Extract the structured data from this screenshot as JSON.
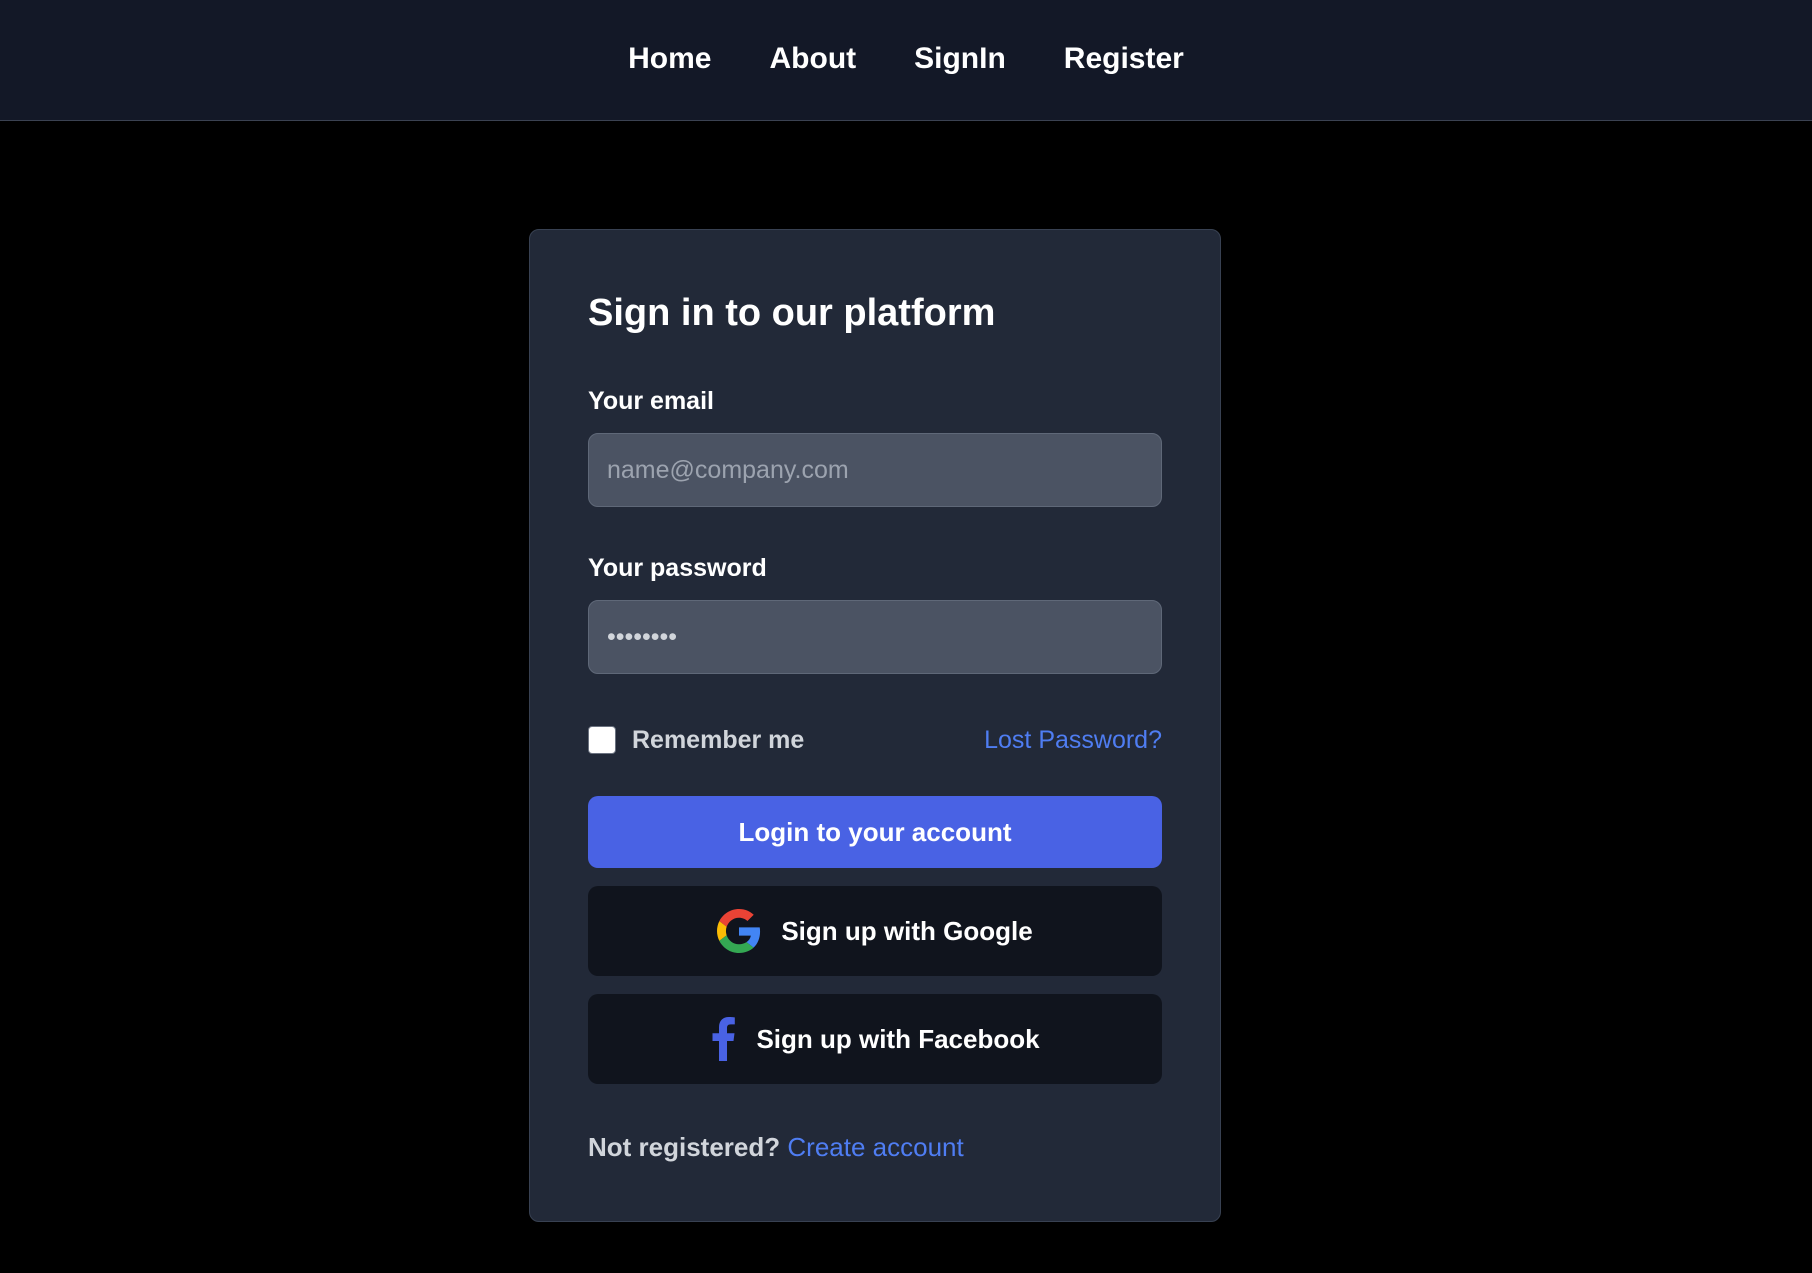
{
  "nav": {
    "items": [
      {
        "label": "Home"
      },
      {
        "label": "About"
      },
      {
        "label": "SignIn"
      },
      {
        "label": "Register"
      }
    ]
  },
  "signin": {
    "title": "Sign in to our platform",
    "email_label": "Your email",
    "email_placeholder": "name@company.com",
    "email_value": "",
    "password_label": "Your password",
    "password_value": "••••••••",
    "remember_label": "Remember me",
    "remember_checked": false,
    "lost_password_label": "Lost Password?",
    "login_button": "Login to your account",
    "google_button": "Sign up with Google",
    "facebook_button": "Sign up with Facebook",
    "not_registered": "Not registered?",
    "create_account": "Create account"
  },
  "icons": {
    "google": "google-g-icon",
    "facebook": "facebook-f-icon"
  },
  "colors": {
    "navbar_bg": "#131827",
    "page_bg": "#000000",
    "card_bg": "#222938",
    "input_bg": "#4b5363",
    "primary": "#4962e4",
    "link": "#4f7df2",
    "social_btn_bg": "#10141d"
  }
}
